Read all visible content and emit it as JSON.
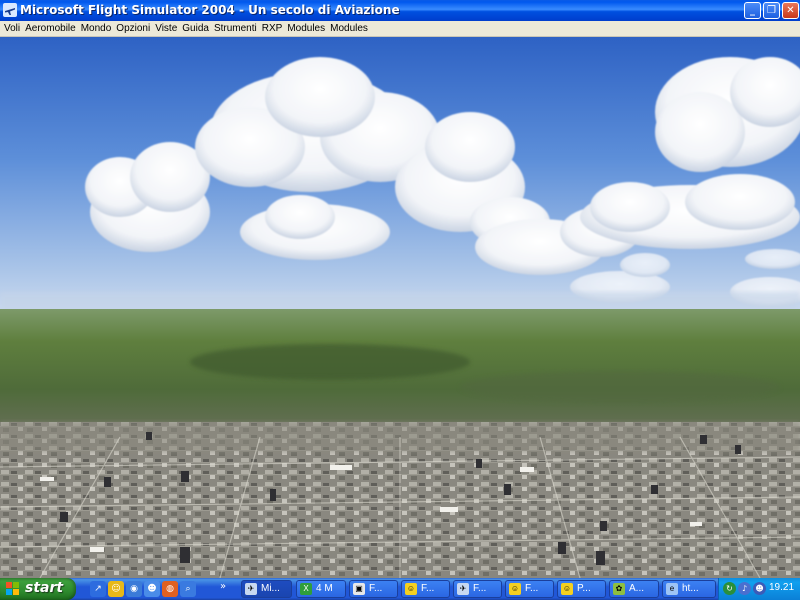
{
  "window": {
    "title": "Microsoft Flight Simulator 2004 - Un secolo di Aviazione",
    "controls": {
      "minimize": "_",
      "maximize": "❐",
      "close": "✕"
    }
  },
  "menu": {
    "items": [
      "Voli",
      "Aeromobile",
      "Mondo",
      "Opzioni",
      "Viste",
      "Guida",
      "Strumenti",
      "RXP",
      "Modules",
      "Modules"
    ]
  },
  "taskbar": {
    "start_label": "start",
    "tasks": [
      {
        "label": "Mi...",
        "icon": "plane-icon",
        "active": true
      },
      {
        "label": "4 M",
        "icon": "excel-icon",
        "active": false
      },
      {
        "label": "F...",
        "icon": "window-icon",
        "active": false
      },
      {
        "label": "F...",
        "icon": "smiley-icon",
        "active": false
      },
      {
        "label": "F...",
        "icon": "plane-icon",
        "active": false
      },
      {
        "label": "F...",
        "icon": "smiley-icon",
        "active": false
      },
      {
        "label": "P...",
        "icon": "smiley-icon",
        "active": false
      },
      {
        "label": "A...",
        "icon": "palette-icon",
        "active": false
      },
      {
        "label": "ht...",
        "icon": "ie-icon",
        "active": false
      }
    ],
    "clock": "19.21"
  },
  "colors": {
    "titlebar": "#0058ee",
    "menubar": "#ece9d8",
    "taskbar": "#2157d7",
    "start": "#3c9f3c",
    "tray": "#0f8ddf"
  }
}
